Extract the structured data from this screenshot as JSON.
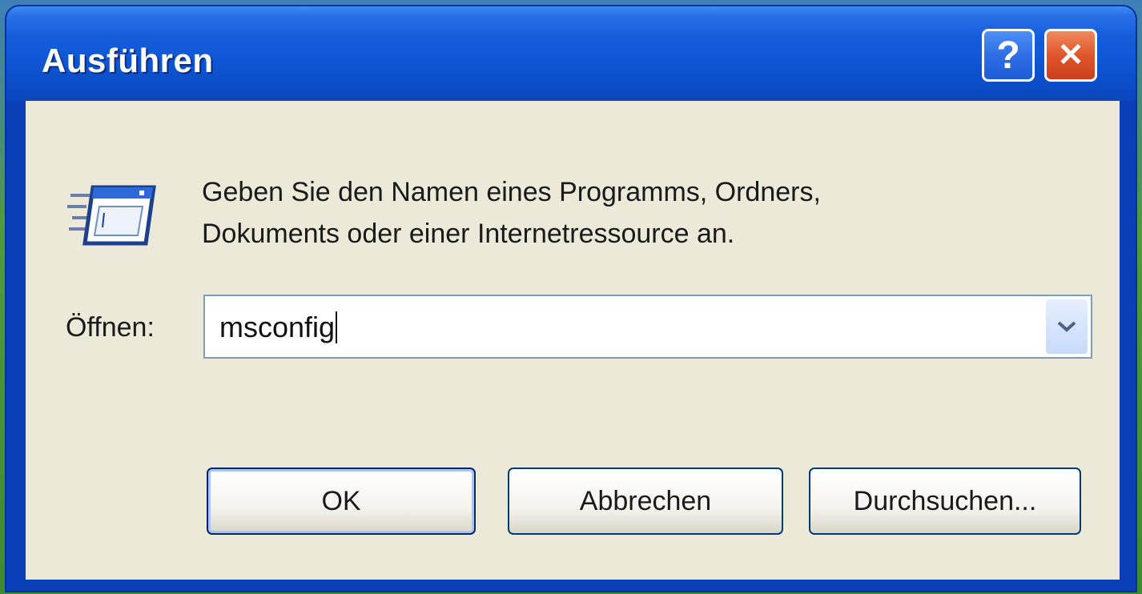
{
  "window": {
    "title": "Ausführen",
    "help_label": "?",
    "close_label": "✕"
  },
  "icons": {
    "run": "run-program-icon",
    "help": "help-icon",
    "close": "close-icon",
    "dropdown": "chevron-down-icon"
  },
  "dialog": {
    "description_line1": "Geben Sie den Namen eines Programms, Ordners,",
    "description_line2": "Dokuments oder einer Internetressource an.",
    "open_label": "Öffnen:",
    "open_value": "msconfig"
  },
  "buttons": {
    "ok": "OK",
    "cancel": "Abbrechen",
    "browse": "Durchsuchen..."
  },
  "colors": {
    "titlebar": "#0e55d3",
    "client": "#ece9d8",
    "close_button": "#e0552c",
    "help_button": "#2f6fe6"
  }
}
